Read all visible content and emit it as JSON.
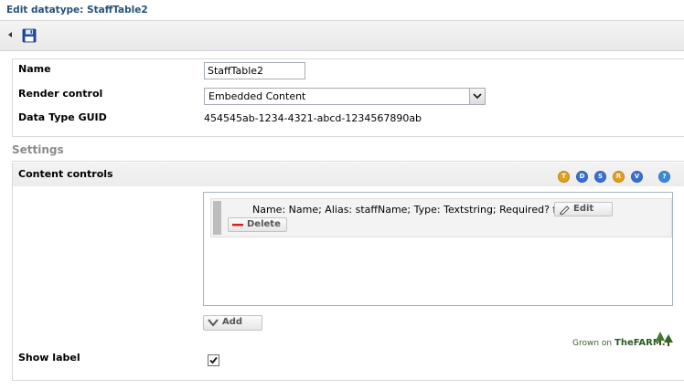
{
  "title_bar": {
    "title": "Edit datatype: StaffTable2"
  },
  "toolbar": {
    "back_arrow": "left-arrow",
    "save_icon": "floppy-disk-icon"
  },
  "form": {
    "name_label": "Name",
    "name_value": "StaffTable2",
    "render_label": "Render control",
    "render_value": "Embedded Content",
    "guid_label": "Data Type GUID",
    "guid_value": "454545ab-1234-4321-abcd-1234567890ab"
  },
  "settings": {
    "title": "Settings",
    "content_controls_label": "Content controls",
    "type_icons": [
      {
        "letter": "T",
        "color": "#e0a020"
      },
      {
        "letter": "D",
        "color": "#3b6fcf"
      },
      {
        "letter": "S",
        "color": "#3b6fcf"
      },
      {
        "letter": "R",
        "color": "#e0a020"
      },
      {
        "letter": "V",
        "color": "#3b6fcf"
      },
      {
        "letter": "?",
        "color": "#3b8ad8"
      }
    ],
    "items": [
      {
        "description": "Name: Name; Alias: staffName; Type: Textstring; Required? false;",
        "edit_label": "Edit",
        "delete_label": "Delete"
      }
    ],
    "add_label": "Add",
    "show_label_label": "Show label",
    "show_label_checked": true
  },
  "footer": {
    "text": "Grown on",
    "brand": "TheFARM."
  }
}
